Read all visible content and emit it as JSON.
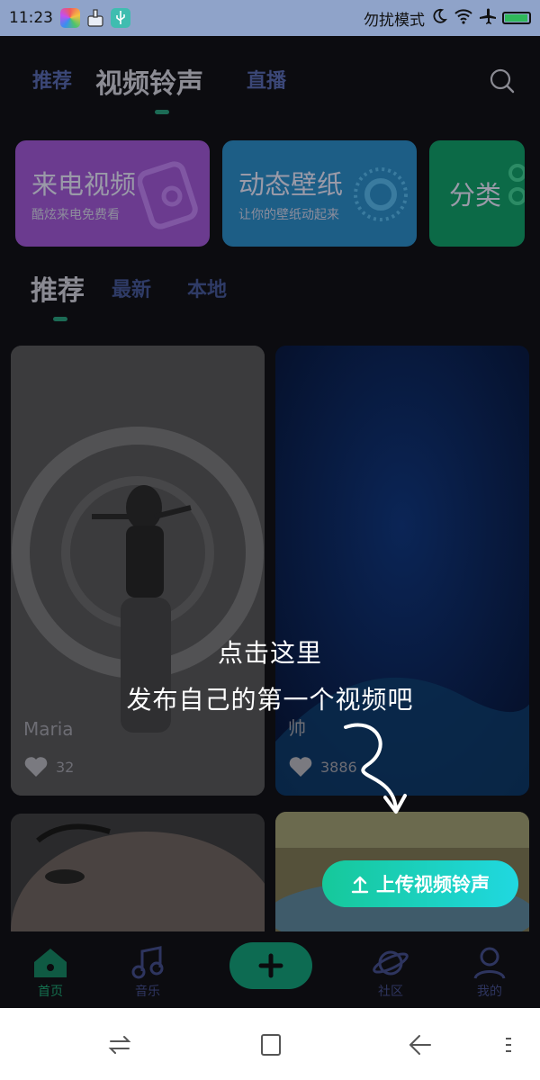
{
  "status_bar": {
    "time": "11:23",
    "mode_text": "勿扰模式",
    "battery_level": 0.9,
    "icons": [
      "photos-app-icon",
      "cleaner-app-icon",
      "usb-icon",
      "moon-icon",
      "wifi-icon",
      "airplane-icon",
      "battery-icon"
    ]
  },
  "top_nav": {
    "tabs": [
      "推荐",
      "视频铃声",
      "直播"
    ],
    "active_index": 1
  },
  "feature_cards": [
    {
      "title": "来电视频",
      "subtitle": "酷炫来电免费看",
      "color": "#6b3b8f"
    },
    {
      "title": "动态壁纸",
      "subtitle": "让你的壁纸动起来",
      "color": "#1d5e86"
    },
    {
      "title": "分类",
      "subtitle": "",
      "color": "#0c6a47"
    }
  ],
  "sub_tabs": {
    "tabs": [
      "推荐",
      "最新",
      "本地"
    ],
    "active_index": 0
  },
  "feed": [
    {
      "name": "Maria",
      "likes": "32"
    },
    {
      "name": "帅",
      "likes": "3886"
    },
    {
      "name": "",
      "likes": ""
    },
    {
      "name": "",
      "likes": ""
    }
  ],
  "onboarding_hint": {
    "line1": "点击这里",
    "line2": "发布自己的第一个视频吧"
  },
  "upload_button_label": "上传视频铃声",
  "bottom_tabs": [
    {
      "label": "首页",
      "icon": "home-icon",
      "active": true
    },
    {
      "label": "音乐",
      "icon": "music-note-icon",
      "active": false
    },
    {
      "label": "",
      "icon": "plus-icon",
      "active": false
    },
    {
      "label": "社区",
      "icon": "planet-icon",
      "active": false
    },
    {
      "label": "我的",
      "icon": "person-icon",
      "active": false
    }
  ],
  "colors": {
    "accent": "#16c89a",
    "accent_dark": "#0d6b52",
    "status_bar": "#8fa3c9"
  }
}
